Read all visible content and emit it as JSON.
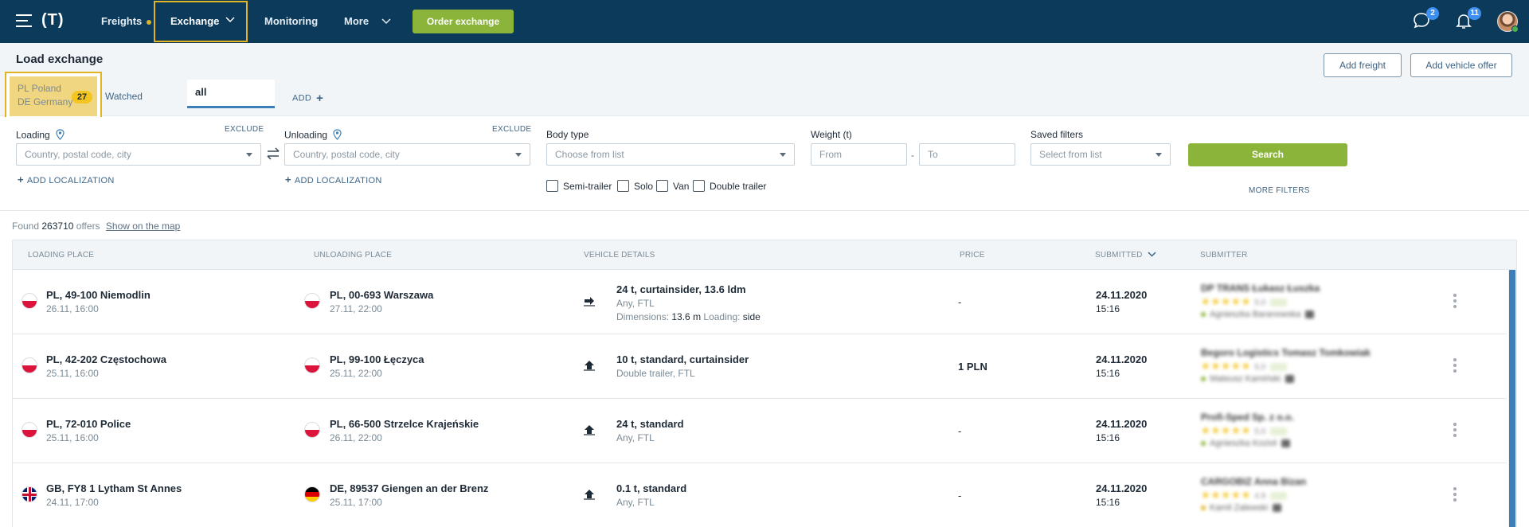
{
  "nav": {
    "freights": "Freights",
    "exchange": "Exchange",
    "monitoring": "Monitoring",
    "more": "More",
    "order_exchange": "Order exchange",
    "messages_count": "2",
    "notifications_count": "11"
  },
  "header": {
    "title": "Load exchange",
    "add_freight": "Add freight",
    "add_vehicle_offer": "Add vehicle offer"
  },
  "tabs": {
    "saved": {
      "line1": "PL Poland",
      "line2": "DE Germany",
      "count": "27"
    },
    "watched": "Watched",
    "all": "all",
    "add": "ADD"
  },
  "filters": {
    "loading_label": "Loading",
    "unloading_label": "Unloading",
    "exclude": "EXCLUDE",
    "location_placeholder": "Country, postal code, city",
    "add_localization": "ADD LOCALIZATION",
    "body_type_label": "Body type",
    "body_type_placeholder": "Choose from list",
    "weight_label": "Weight (t)",
    "weight_from": "From",
    "weight_to": "To",
    "saved_filters_label": "Saved filters",
    "saved_filters_placeholder": "Select from list",
    "search": "Search",
    "more_filters": "MORE FILTERS",
    "checkboxes": [
      "Semi-trailer",
      "Solo",
      "Van",
      "Double trailer"
    ]
  },
  "results": {
    "found_prefix": "Found",
    "count": "263710",
    "offers": "offers",
    "show_map": "Show on the map"
  },
  "columns": {
    "loading": "LOADING PLACE",
    "unloading": "UNLOADING PLACE",
    "vehicle": "VEHICLE DETAILS",
    "price": "PRICE",
    "submitted": "SUBMITTED",
    "submitter": "SUBMITTER"
  },
  "rows": [
    {
      "load_city": "PL, 49-100 Niemodlin",
      "load_date": "26.11, 16:00",
      "load_flag": "pl",
      "unload_city": "PL, 00-693 Warszawa",
      "unload_date": "27.11, 22:00",
      "unload_flag": "pl",
      "vehicle": "24 t, curtainsider, 13.6 ldm",
      "vehicle_sub": "Any, FTL",
      "dims_label": "Dimensions:",
      "dims_value": "13.6 m",
      "loading_label": "Loading:",
      "loading_value": "side",
      "price": "-",
      "sub_date": "24.11.2020",
      "sub_time": "15:16",
      "submitter_name": "DP TRANS Łukasz Łuszka",
      "submitter_rating": "5.0",
      "submitter_person": "Agnieszka Baranowska"
    },
    {
      "load_city": "PL, 42-202 Częstochowa",
      "load_date": "25.11, 16:00",
      "load_flag": "pl",
      "unload_city": "PL, 99-100 Łęczyca",
      "unload_date": "25.11, 22:00",
      "unload_flag": "pl",
      "vehicle": "10 t, standard, curtainsider",
      "vehicle_sub": "Double trailer, FTL",
      "price": "1 PLN",
      "sub_date": "24.11.2020",
      "sub_time": "15:16",
      "submitter_name": "Begoro Logistics Tomasz Tomkowiak",
      "submitter_rating": "5.0",
      "submitter_person": "Mateusz Kamiński"
    },
    {
      "load_city": "PL, 72-010 Police",
      "load_date": "25.11, 16:00",
      "load_flag": "pl",
      "unload_city": "PL, 66-500 Strzelce Krajeńskie",
      "unload_date": "26.11, 22:00",
      "unload_flag": "pl",
      "vehicle": "24 t, standard",
      "vehicle_sub": "Any, FTL",
      "price": "-",
      "sub_date": "24.11.2020",
      "sub_time": "15:16",
      "submitter_name": "Profi-Sped Sp. z o.o.",
      "submitter_rating": "5.0",
      "submitter_person": "Agnieszka Kozioł"
    },
    {
      "load_city": "GB, FY8 1 Lytham St Annes",
      "load_date": "24.11, 17:00",
      "load_flag": "gb",
      "unload_city": "DE, 89537 Giengen an der Brenz",
      "unload_date": "25.11, 17:00",
      "unload_flag": "de",
      "vehicle": "0.1 t, standard",
      "vehicle_sub": "Any, FTL",
      "price": "-",
      "sub_date": "24.11.2020",
      "sub_time": "15:16",
      "submitter_name": "CARGOBIZ Anna Bizan",
      "submitter_rating": "4.9",
      "submitter_person": "Kamil Zalewski"
    }
  ]
}
